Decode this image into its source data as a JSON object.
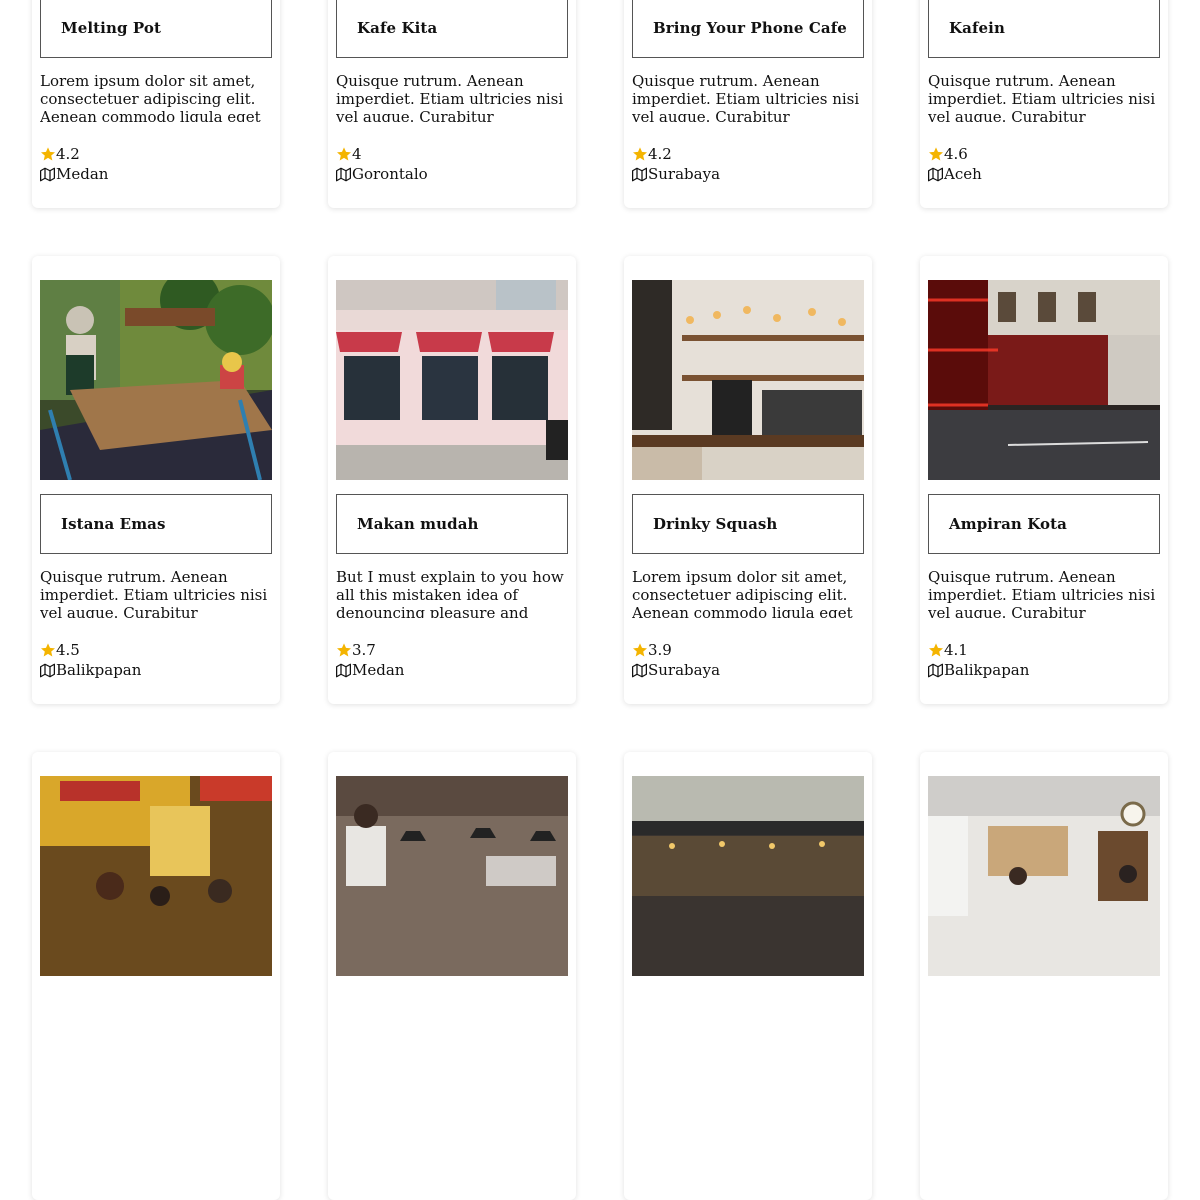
{
  "colors": {
    "star": "#f4b400",
    "border": "#555555"
  },
  "icons": {
    "rating": "star-icon",
    "location": "map-icon"
  },
  "cards": [
    {
      "title": "Melting Pot",
      "description": "Lorem ipsum dolor sit amet, consectetuer adipiscing elit. Aenean commodo ligula eget dolor. Aenean massa. Cum sociis",
      "rating": "4.2",
      "city": "Medan"
    },
    {
      "title": "Kafe Kita",
      "description": "Quisque rutrum. Aenean imperdiet. Etiam ultricies nisi vel augue. Curabitur ullamcorper ultricies nisi. Nam eget dui. Etiam",
      "rating": "4",
      "city": "Gorontalo"
    },
    {
      "title": "Bring Your Phone Cafe",
      "description": "Quisque rutrum. Aenean imperdiet. Etiam ultricies nisi vel augue. Curabitur ullamcorper ultricies nisi. Nam eget dui. Etiam",
      "rating": "4.2",
      "city": "Surabaya"
    },
    {
      "title": "Kafein",
      "description": "Quisque rutrum. Aenean imperdiet. Etiam ultricies nisi vel augue. Curabitur ullamcorper ultricies nisi. Nam eget dui. Etiam",
      "rating": "4.6",
      "city": "Aceh"
    },
    {
      "title": "Istana Emas",
      "description": "Quisque rutrum. Aenean imperdiet. Etiam ultricies nisi vel augue. Curabitur ullamcorper ultricies nisi. Nam eget dui. Etiam",
      "rating": "4.5",
      "city": "Balikpapan"
    },
    {
      "title": "Makan mudah",
      "description": "But I must explain to you how all this mistaken idea of denouncing pleasure and praising pain was born and I will give you a complete",
      "rating": "3.7",
      "city": "Medan"
    },
    {
      "title": "Drinky Squash",
      "description": "Lorem ipsum dolor sit amet, consectetuer adipiscing elit. Aenean commodo ligula eget dolor. Aenean massa. Cum sociis",
      "rating": "3.9",
      "city": "Surabaya"
    },
    {
      "title": "Ampiran Kota",
      "description": "Quisque rutrum. Aenean imperdiet. Etiam ultricies nisi vel augue. Curabitur ullamcorper ultricies nisi. Nam eget dui. Etiam",
      "rating": "4.1",
      "city": "Balikpapan"
    },
    {
      "title": "",
      "description": "",
      "rating": "",
      "city": ""
    },
    {
      "title": "",
      "description": "",
      "rating": "",
      "city": ""
    },
    {
      "title": "",
      "description": "",
      "rating": "",
      "city": ""
    },
    {
      "title": "",
      "description": "",
      "rating": "",
      "city": ""
    }
  ]
}
